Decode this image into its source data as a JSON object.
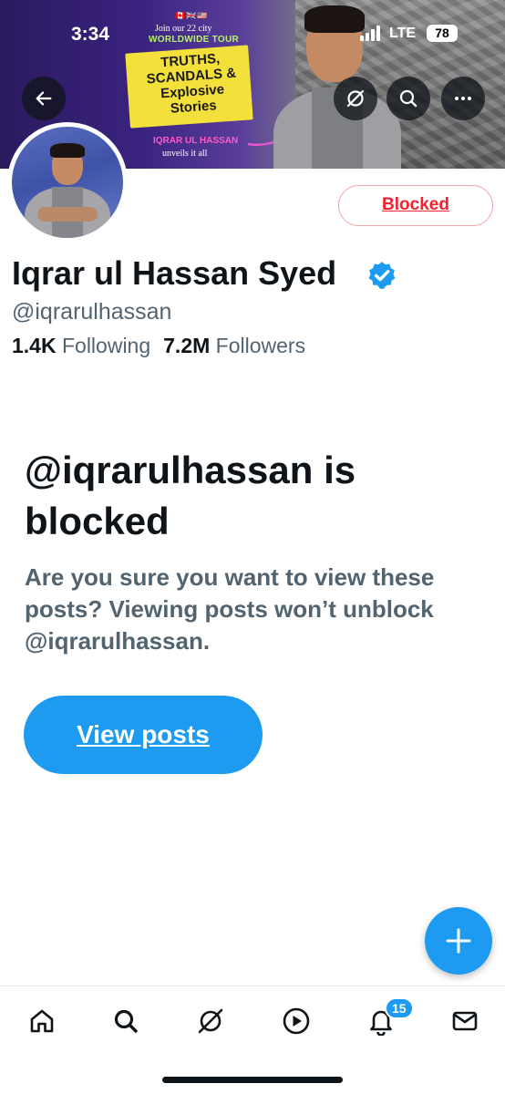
{
  "status_bar": {
    "time": "3:34",
    "network": "LTE",
    "battery": "78"
  },
  "banner": {
    "flags": "🇨🇦🇬🇧🇺🇸",
    "tour_line1": "Join our 22 city",
    "tour_line2": "WORLDWIDE TOUR",
    "headline": "TRUTHS, SCANDALS & Explosive Stories",
    "name_tag": "IQRAR UL HASSAN",
    "tagline": "unveils it all"
  },
  "header_actions": {
    "back_icon": "back-arrow-icon",
    "grok_icon": "grok-icon",
    "search_icon": "search-icon",
    "more_icon": "more-icon"
  },
  "profile": {
    "display_name": "Iqrar ul Hassan Syed",
    "handle": "@iqrarulhassan",
    "following_count": "1.4K",
    "following_label": "Following",
    "followers_count": "7.2M",
    "followers_label": "Followers",
    "blocked_button_label": "Blocked",
    "verified_color": "#1d9bf0"
  },
  "blocked_notice": {
    "title": "@iqrarulhassan is blocked",
    "description": "Are you sure you want to view these posts? Viewing posts won’t unblock @iqrarulhassan.",
    "view_posts_label": "View posts"
  },
  "fab": {
    "icon": "plus-icon"
  },
  "tab_bar": {
    "items": [
      {
        "name": "home",
        "icon": "home-icon"
      },
      {
        "name": "search",
        "icon": "search-icon"
      },
      {
        "name": "grok",
        "icon": "grok-icon"
      },
      {
        "name": "video",
        "icon": "play-icon"
      },
      {
        "name": "notifications",
        "icon": "bell-icon"
      },
      {
        "name": "messages",
        "icon": "envelope-icon"
      }
    ],
    "notifications_badge": "15"
  },
  "colors": {
    "accent": "#1d9bf0",
    "blocked_red": "#f4212e",
    "text_primary": "#0f1419",
    "text_secondary": "#536471"
  }
}
